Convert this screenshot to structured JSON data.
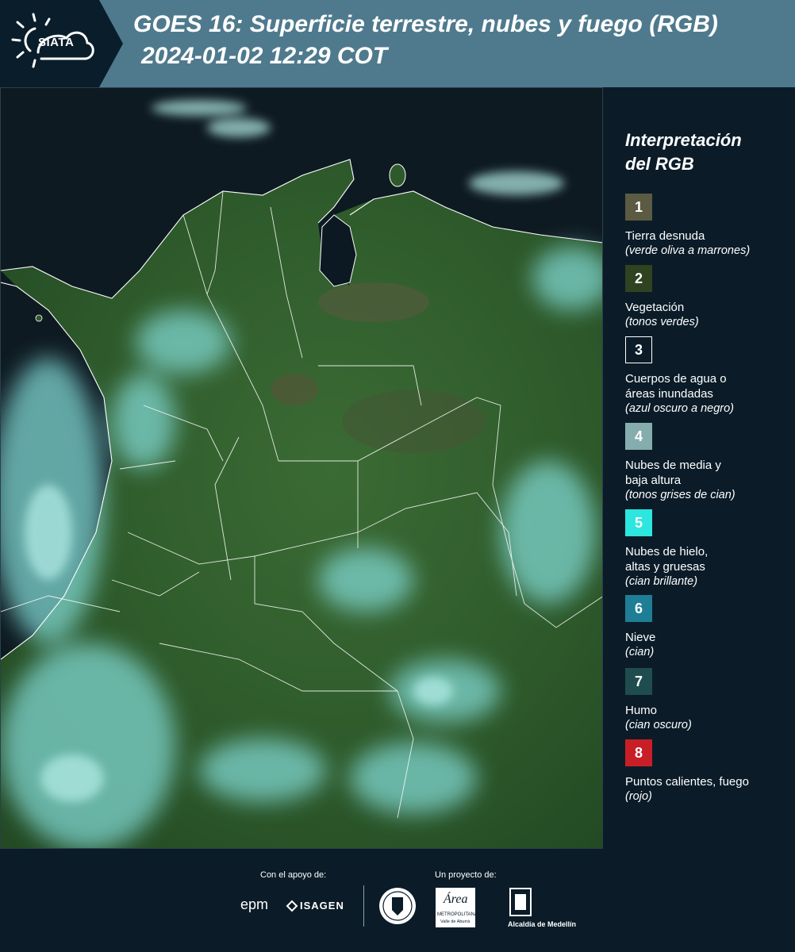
{
  "header": {
    "logo_text": "SIATA",
    "title_line1": "GOES 16: Superficie terrestre, nubes y fuego (RGB)",
    "title_line2": "2024-01-02 12:29 COT"
  },
  "legend": {
    "title_line1": "Interpretación",
    "title_line2": "del RGB",
    "items": [
      {
        "num": "1",
        "color": "#5b5a42",
        "label_lines": [
          "Tierra desnuda"
        ],
        "desc": "(verde oliva a marrones)"
      },
      {
        "num": "2",
        "color": "#2f4320",
        "label_lines": [
          "Vegetación"
        ],
        "desc": "(tonos verdes)"
      },
      {
        "num": "3",
        "color": "#0b1c28",
        "label_lines": [
          "Cuerpos de agua o",
          "áreas inundadas"
        ],
        "desc": "(azul oscuro a negro)"
      },
      {
        "num": "4",
        "color": "#86adad",
        "label_lines": [
          "Nubes de media y",
          "baja altura"
        ],
        "desc": "(tonos grises de cian)"
      },
      {
        "num": "5",
        "color": "#2de6e0",
        "label_lines": [
          "Nubes de hielo,",
          "altas y gruesas"
        ],
        "desc": "(cian brillante)"
      },
      {
        "num": "6",
        "color": "#1d7e96",
        "label_lines": [
          "Nieve"
        ],
        "desc": "(cian)"
      },
      {
        "num": "7",
        "color": "#1e4c4f",
        "label_lines": [
          "Humo"
        ],
        "desc": "(cian oscuro)"
      },
      {
        "num": "8",
        "color": "#c81f26",
        "label_lines": [
          "Puntos calientes, fuego"
        ],
        "desc": "(rojo)"
      }
    ]
  },
  "footer": {
    "support_label": "Con el apoyo de:",
    "project_label": "Un proyecto de:",
    "epm": "epm",
    "isagen": "ISAGEN",
    "area": "Área",
    "area_sub": "METROPOLITANA",
    "area_sub2": "Valle de Aburrá",
    "medellin": "Alcaldía de Medellín"
  }
}
